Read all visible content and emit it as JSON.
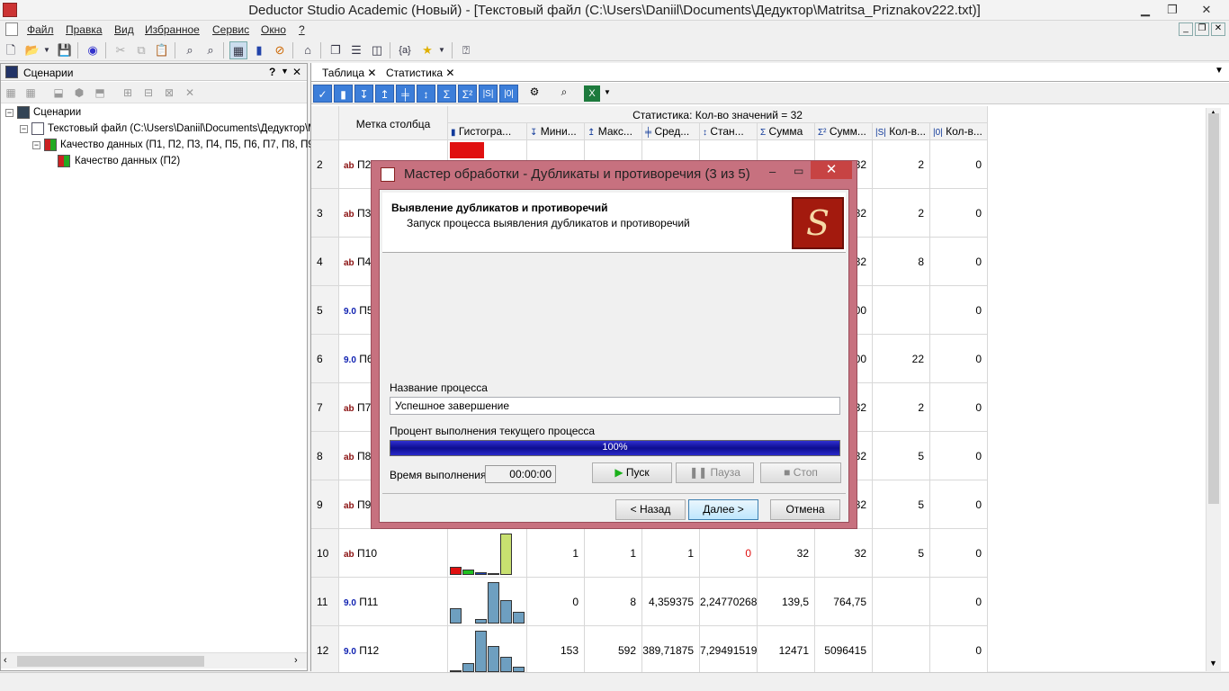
{
  "window": {
    "title": "Deductor Studio Academic (Новый) - [Текстовый файл (C:\\Users\\Daniil\\Documents\\Дедуктор\\Matritsa_Priznakov222.txt)]"
  },
  "menu": [
    "Файл",
    "Правка",
    "Вид",
    "Избранное",
    "Сервис",
    "Окно",
    "?"
  ],
  "left_panel": {
    "title": "Сценарии",
    "help": "?",
    "tree": [
      {
        "label": "Сценарии",
        "level": 0,
        "expanded": "−"
      },
      {
        "label": "Текстовый файл (C:\\Users\\Daniil\\Documents\\Дедуктор\\M",
        "level": 1,
        "expanded": "−"
      },
      {
        "label": "Качество данных (П1, П2, П3, П4, П5, П6, П7, П8, П9,",
        "level": 2,
        "expanded": "−"
      },
      {
        "label": "Качество данных (П2)",
        "level": 3
      }
    ]
  },
  "tabs": [
    {
      "label": "Таблица"
    },
    {
      "label": "Статистика"
    }
  ],
  "tab_close": "✕",
  "grid": {
    "col_label_header": "Метка столбца",
    "stat_header": "Статистика: Кол-во значений = 32",
    "columns": [
      {
        "icon": "▮",
        "label": "Гистогра..."
      },
      {
        "icon": "↧",
        "label": "Мини..."
      },
      {
        "icon": "↥",
        "label": "Макс..."
      },
      {
        "icon": "╪",
        "label": "Сред..."
      },
      {
        "icon": "↕",
        "label": "Стан..."
      },
      {
        "icon": "Σ",
        "label": "Сумма"
      },
      {
        "icon": "Σ²",
        "label": "Сумм..."
      },
      {
        "icon": "|S|",
        "label": "Кол-в..."
      },
      {
        "icon": "|0|",
        "label": "Кол-в..."
      }
    ],
    "rows": [
      {
        "n": "2",
        "type": "ab",
        "label": "П2",
        "sum2": "32",
        "cnt": "2",
        "zero": "0"
      },
      {
        "n": "3",
        "type": "ab",
        "label": "П3",
        "sum2": "32",
        "cnt": "2",
        "zero": "0"
      },
      {
        "n": "4",
        "type": "ab",
        "label": "П4",
        "sum2": "32",
        "cnt": "8",
        "zero": "0"
      },
      {
        "n": "5",
        "type": "9.0",
        "label": "П5",
        "sum2": "00",
        "cnt": "",
        "zero": "0"
      },
      {
        "n": "6",
        "type": "9.0",
        "label": "П6",
        "sum2": "00",
        "cnt": "22",
        "zero": "0"
      },
      {
        "n": "7",
        "type": "ab",
        "label": "П7",
        "sum2": "32",
        "cnt": "2",
        "zero": "0"
      },
      {
        "n": "8",
        "type": "ab",
        "label": "П8",
        "sum2": "32",
        "cnt": "5",
        "zero": "0"
      },
      {
        "n": "9",
        "type": "ab",
        "label": "П9",
        "sum2": "32",
        "cnt": "5",
        "zero": "0"
      },
      {
        "n": "10",
        "type": "ab",
        "label": "П10",
        "min": "1",
        "max": "1",
        "avg": "1",
        "std": "0",
        "sum": "32",
        "sum2": "32",
        "cnt": "5",
        "zero": "0"
      },
      {
        "n": "11",
        "type": "9.0",
        "label": "П11",
        "min": "0",
        "max": "8",
        "avg": "4,359375",
        "std": "2,24770268",
        "sum": "139,5",
        "sum2": "764,75",
        "cnt": "",
        "zero": "0"
      },
      {
        "n": "12",
        "type": "9.0",
        "label": "П12",
        "min": "153",
        "max": "592",
        "avg": "389,71875",
        "std": "7,29491519",
        "sum": "12471",
        "sum2": "5096415",
        "cnt": "",
        "zero": "0"
      }
    ]
  },
  "dialog": {
    "title": "Мастер обработки - Дубликаты и противоречия (3 из 5)",
    "heading": "Выявление дубликатов и противоречий",
    "subheading": "Запуск процесса выявления дубликатов и противоречий",
    "process_name_label": "Название процесса",
    "process_name_value": "Успешное завершение",
    "progress_label": "Процент выполнения текущего процесса",
    "progress_value": 1.0,
    "progress_text": "100%",
    "time_label": "Время выполнения",
    "time_value": "00:00:00",
    "btn_start": "Пуск",
    "btn_pause": "Пауза",
    "btn_stop": "Стоп",
    "btn_back": "< Назад",
    "btn_next": "Далее >",
    "btn_cancel": "Отмена"
  },
  "colors": {
    "accent": "#3c7ed9",
    "dialog_frame": "#c7717f",
    "progress": "#1515b0",
    "hist_red": "#e01010",
    "hist_green": "#20c020",
    "hist_blue": "#1a3fb0",
    "hist_lime": "#c8e070",
    "hist_steel": "#6e9fc0"
  }
}
